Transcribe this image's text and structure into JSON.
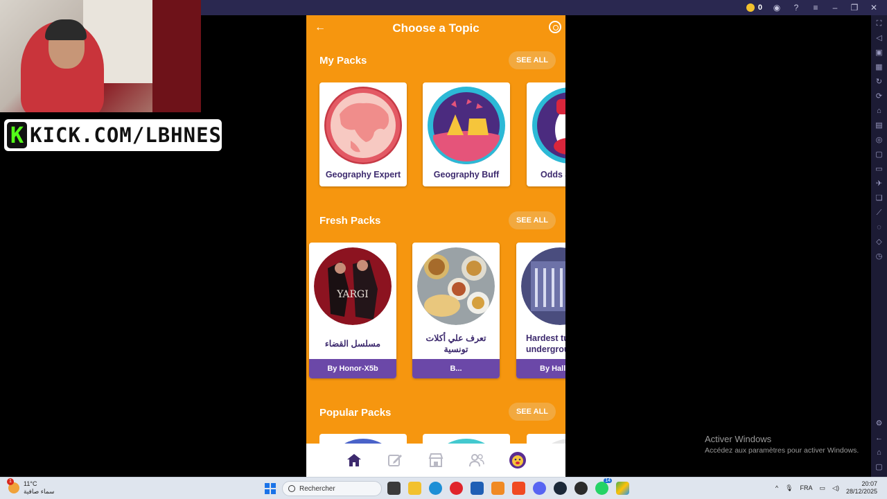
{
  "emulator": {
    "coins": "0",
    "colors": {
      "topbar": "#2a2850",
      "sidebar": "#1c1b34"
    }
  },
  "stream": {
    "banner_text": "KICK.COM/LBHNES",
    "logo_letter": "K"
  },
  "app": {
    "title": "Choose a Topic",
    "accent": "#f6960f",
    "sections": {
      "my_packs": {
        "title": "My Packs",
        "see_all": "SEE ALL",
        "cards": [
          {
            "label": "Geography Expert",
            "icon": "globe-icon"
          },
          {
            "label": "Geography Buff",
            "icon": "landmarks-icon"
          },
          {
            "label": "Odds a",
            "icon": "character-icon"
          }
        ]
      },
      "fresh_packs": {
        "title": "Fresh Packs",
        "see_all": "SEE ALL",
        "cards": [
          {
            "label": "مسلسل القضاء",
            "by": "By Honor-X5b",
            "art_caption": "YARGI"
          },
          {
            "label": "تعرف علي أكلات تونسية",
            "by": "B..."
          },
          {
            "label": "Hardest tu undergrou",
            "by": "By Halle"
          }
        ]
      },
      "popular_packs": {
        "title": "Popular Packs",
        "see_all": "SEE ALL"
      }
    },
    "bottom_nav": [
      "home-icon",
      "edit-icon",
      "store-icon",
      "friends-icon",
      "profile-avatar-icon"
    ]
  },
  "watermark": {
    "title": "Activer Windows",
    "subtitle": "Accédez aux paramètres pour activer Windows."
  },
  "taskbar": {
    "weather_badge": "1",
    "temperature": "11°C",
    "weather_desc": "سماء صافية",
    "search_placeholder": "Rechercher",
    "language": "FRA",
    "time": "20:07",
    "date": "28/12/2025",
    "whatsapp_badge": "14"
  }
}
